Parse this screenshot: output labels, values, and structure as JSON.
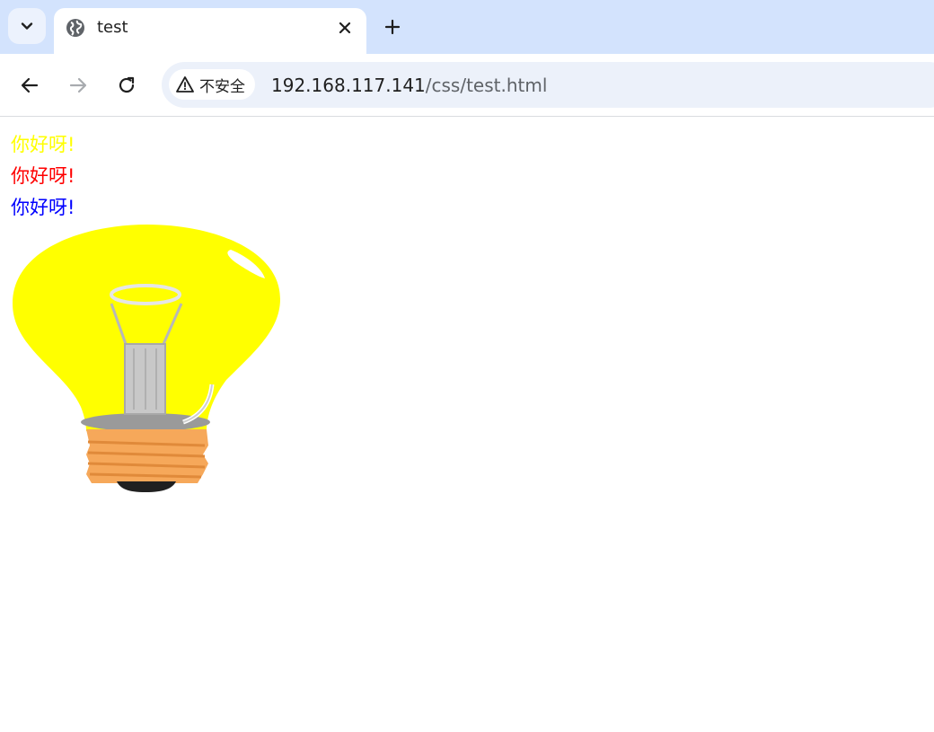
{
  "browser": {
    "tab": {
      "title": "test",
      "favicon": "globe-icon"
    },
    "toolbar": {
      "security_label": "不安全",
      "url_host": "192.168.117.141",
      "url_path": "/css/test.html"
    },
    "icons": [
      "chevron-down-icon",
      "close-icon",
      "plus-icon",
      "back-arrow-icon",
      "forward-arrow-icon",
      "reload-icon",
      "warning-icon"
    ]
  },
  "page": {
    "lines": [
      {
        "text": "你好呀!",
        "color": "#ffff00"
      },
      {
        "text": "你好呀!",
        "color": "#ff0000"
      },
      {
        "text": "你好呀!",
        "color": "#0000ff"
      }
    ],
    "image": "light-bulb"
  },
  "colors": {
    "tabstrip": "#d3e3fd",
    "omnibox": "#ecf1fa"
  }
}
